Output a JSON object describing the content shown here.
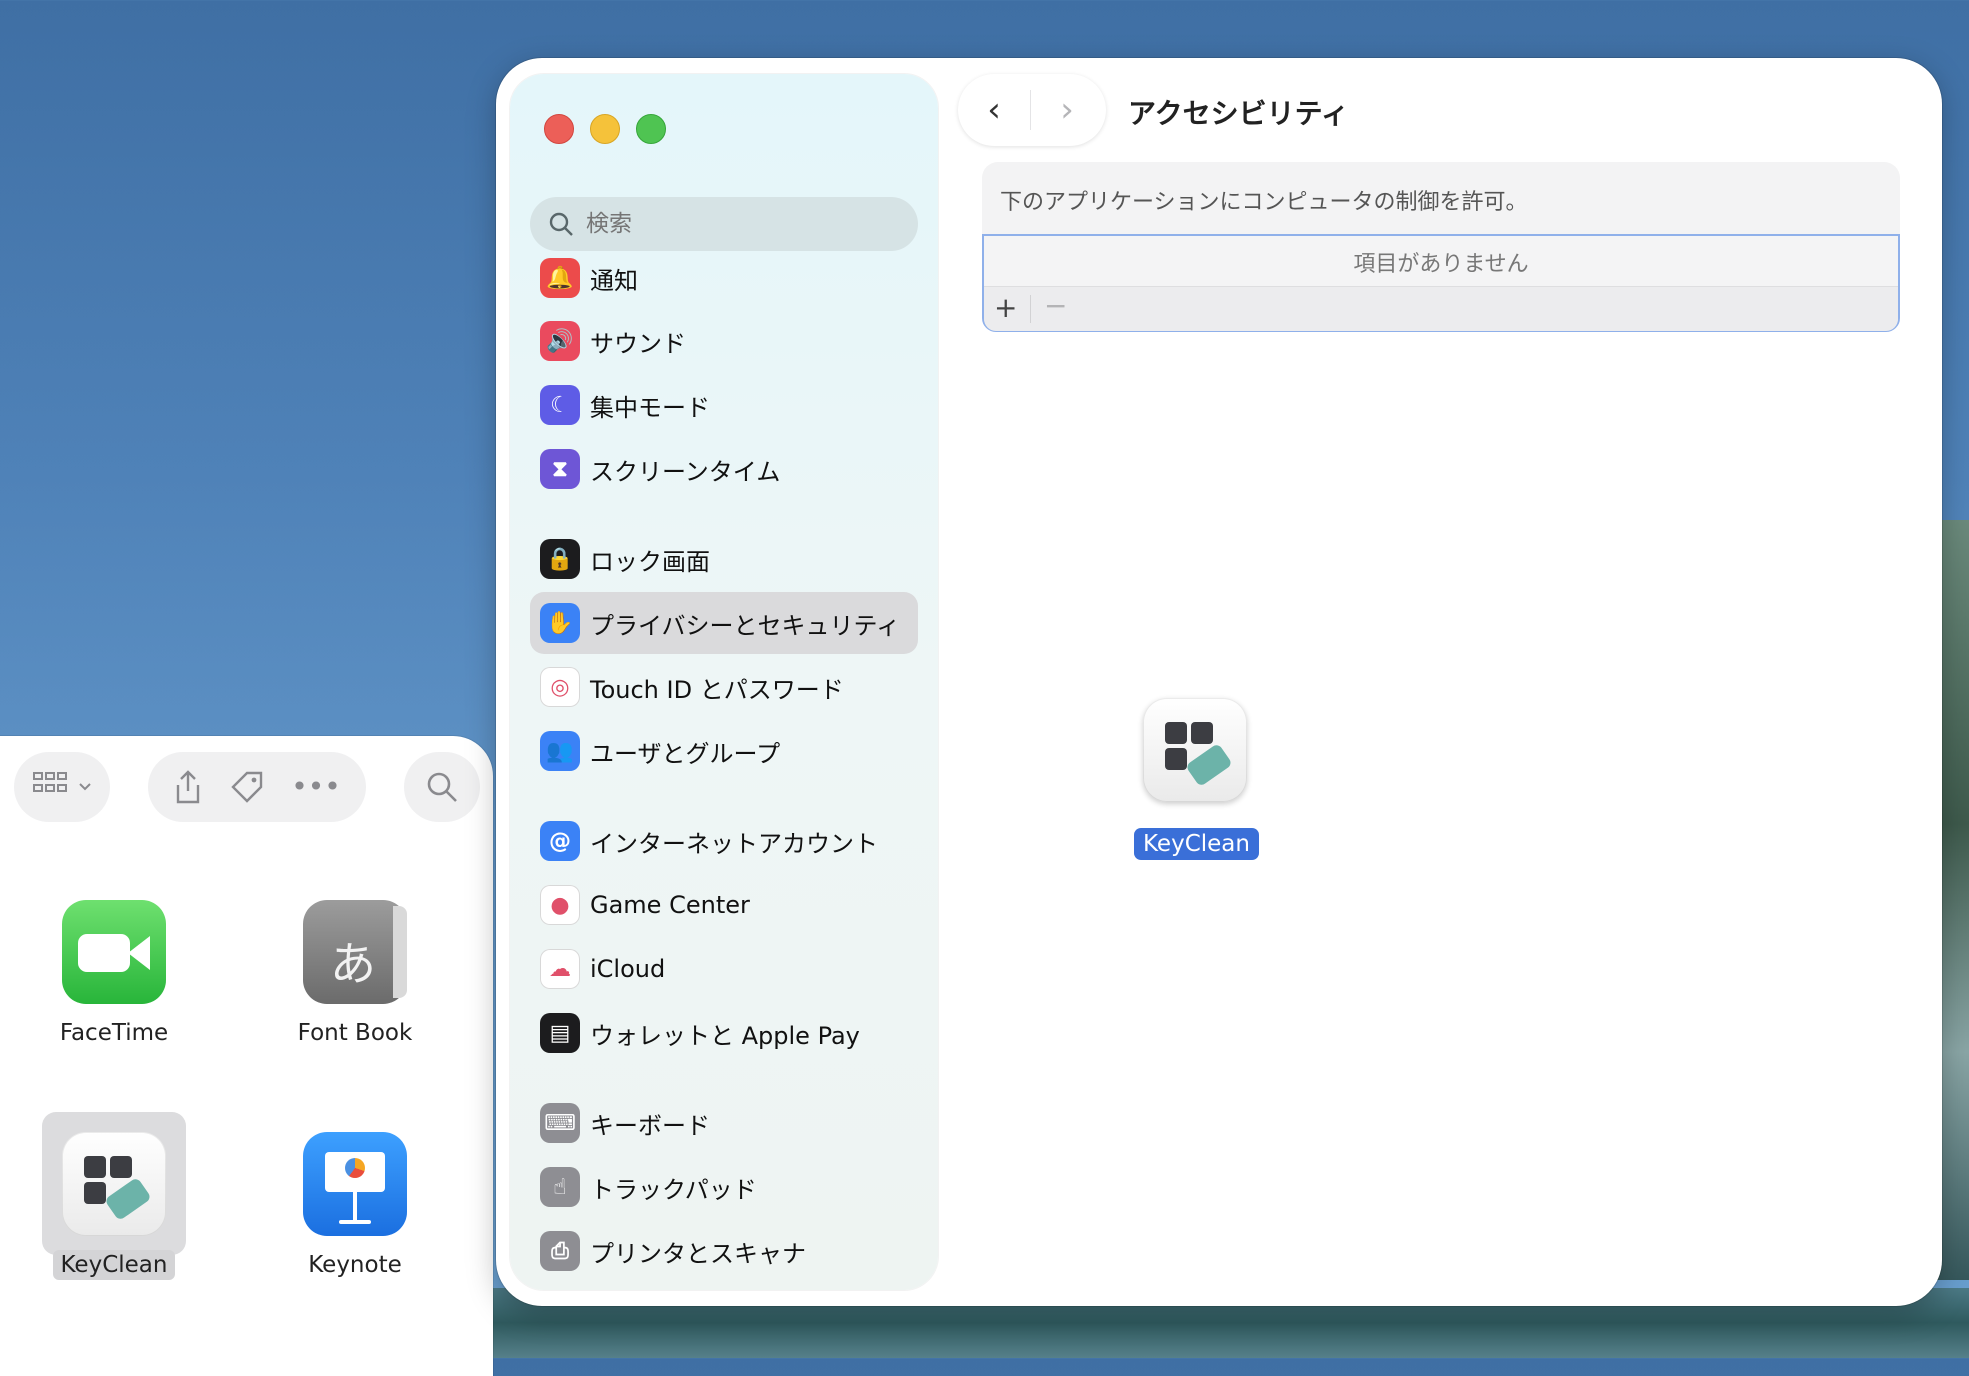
{
  "settings_window": {
    "title": "アクセシビリティ",
    "search_placeholder": "検索",
    "nav_back": "‹",
    "nav_forward": "›",
    "description": "下のアプリケーションにコンピュータの制御を許可。",
    "empty_list_text": "項目がありません",
    "add_label": "+",
    "remove_label": "−",
    "sidebar_items": [
      {
        "label": "通知",
        "icon": "bell-icon",
        "color": "#ec4b4b"
      },
      {
        "label": "サウンド",
        "icon": "speaker-icon",
        "color": "#ea4a5e"
      },
      {
        "label": "集中モード",
        "icon": "moon-icon",
        "color": "#5e5ce6"
      },
      {
        "label": "スクリーンタイム",
        "icon": "hourglass-icon",
        "color": "#6e56d6"
      },
      {
        "label": "ロック画面",
        "icon": "lock-icon",
        "color": "#1c1c1e"
      },
      {
        "label": "プライバシーとセキュリティ",
        "icon": "hand-icon",
        "color": "#3b82f6",
        "selected": true
      },
      {
        "label": "Touch ID とパスワード",
        "icon": "fingerprint-icon",
        "color": "#ffffff"
      },
      {
        "label": "ユーザとグループ",
        "icon": "users-icon",
        "color": "#3b82f6"
      },
      {
        "label": "インターネットアカウント",
        "icon": "at-icon",
        "color": "#3b82f6"
      },
      {
        "label": "Game Center",
        "icon": "game-center-icon",
        "color": "#ffffff"
      },
      {
        "label": "iCloud",
        "icon": "cloud-icon",
        "color": "#ffffff"
      },
      {
        "label": "ウォレットと Apple Pay",
        "icon": "wallet-icon",
        "color": "#1c1c1e"
      },
      {
        "label": "キーボード",
        "icon": "keyboard-icon",
        "color": "#8e8e93"
      },
      {
        "label": "トラックパッド",
        "icon": "trackpad-icon",
        "color": "#8e8e93"
      },
      {
        "label": "プリンタとスキャナ",
        "icon": "printer-icon",
        "color": "#8e8e93"
      }
    ]
  },
  "dragged_app": {
    "label": "KeyClean"
  },
  "finder": {
    "apps": [
      {
        "label": "FaceTime",
        "icon": "facetime-icon"
      },
      {
        "label": "Font Book",
        "icon": "font-book-icon",
        "glyph": "あ"
      },
      {
        "label": "KeyClean",
        "icon": "keyclean-icon"
      },
      {
        "label": "Keynote",
        "icon": "keynote-icon"
      }
    ]
  },
  "colors": {
    "accent": "#3a6fd8",
    "list_border": "#8fb0ea"
  }
}
